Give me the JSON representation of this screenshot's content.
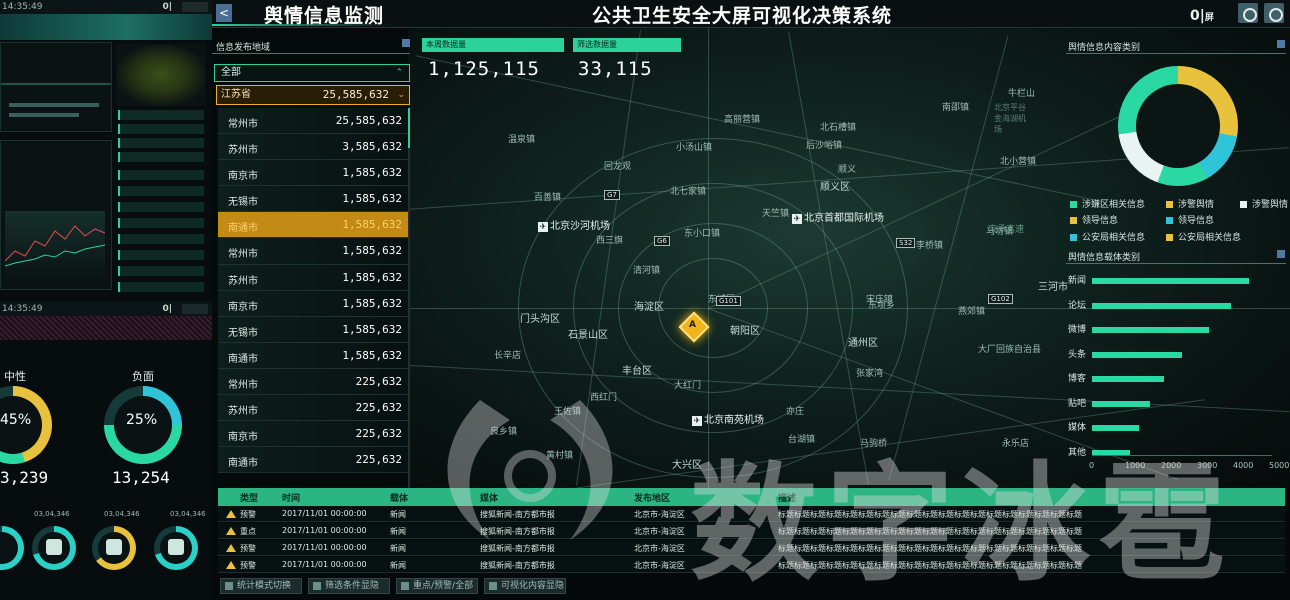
{
  "header": {
    "page_title": "舆情信息监测",
    "main_title": "公共卫生安全大屏可视化决策系统",
    "back_label": "<",
    "screen_toggle": "0|",
    "screen_toggle_suffix": "屏"
  },
  "left_strip": {
    "clock_top": "14:35:49",
    "clock_mid": "14:35:49",
    "neutral_label": "中性",
    "negative_label": "负面",
    "neutral_pct": "45%",
    "negative_pct": "25%",
    "neutral_count": "3,239",
    "negative_count": "13,254",
    "mini_counts": [
      "03,04,346",
      "03,04,346",
      "03,04,346"
    ]
  },
  "region": {
    "title": "信息发布地域",
    "all_label": "全部",
    "province": {
      "name": "江苏省",
      "value": "25,585,632"
    },
    "cities": [
      {
        "name": "常州市",
        "value": "25,585,632"
      },
      {
        "name": "苏州市",
        "value": "3,585,632"
      },
      {
        "name": "南京市",
        "value": "1,585,632"
      },
      {
        "name": "无锡市",
        "value": "1,585,632"
      },
      {
        "name": "南通市",
        "value": "1,585,632"
      },
      {
        "name": "常州市",
        "value": "1,585,632"
      },
      {
        "name": "苏州市",
        "value": "1,585,632"
      },
      {
        "name": "南京市",
        "value": "1,585,632"
      },
      {
        "name": "无锡市",
        "value": "1,585,632"
      },
      {
        "name": "南通市",
        "value": "1,585,632"
      },
      {
        "name": "常州市",
        "value": "225,632"
      },
      {
        "name": "苏州市",
        "value": "225,632"
      },
      {
        "name": "南京市",
        "value": "225,632"
      },
      {
        "name": "南通市",
        "value": "225,632"
      }
    ],
    "selected_index": 4
  },
  "counters": {
    "weekly_label": "本周数据量",
    "weekly_value": "1,125,115",
    "filtered_label": "筛选数据量",
    "filtered_value": "33,115"
  },
  "map": {
    "places": {
      "p1": "百善镇",
      "p2": "西三旗",
      "p3": "清河镇",
      "p4": "温泉镇",
      "p5": "回龙观",
      "p6": "北七家镇",
      "p7": "东小口镇",
      "p8": "小汤山镇",
      "p9": "后沙峪镇",
      "p10": "顺义区",
      "p11": "北石槽镇",
      "p12": "北小营镇",
      "p13": "李桥镇",
      "p14": "东坝乡",
      "p15": "海淀区",
      "p16": "朝阳区",
      "p17": "石景山区",
      "p18": "门头沟区",
      "p19": "丰台区",
      "p20": "东城区",
      "p21": "大兴区",
      "p22": "通州区",
      "p23": "宋庄镇",
      "p24": "马驹桥",
      "p25": "大红门",
      "p26": "亦庄",
      "p27": "台湖镇",
      "p28": "永乐店",
      "p29": "三河市",
      "p30": "燕郊镇",
      "p31": "长辛店",
      "p32": "王佐镇",
      "p33": "良乡镇",
      "p34": "黄村镇",
      "p35": "西红门",
      "p36": "张家湾",
      "p37": "大厂回族自治县",
      "p38": "马坊镇",
      "p39": "顺义",
      "p40": "牛栏山",
      "p41": "南邵镇",
      "p42": "北京平谷金海湖机场",
      "p43": "京承高速",
      "p44": "高丽营镇",
      "p45": "天竺镇"
    },
    "airports": {
      "a1": "北京首都国际机场",
      "a2": "北京南苑机场",
      "a3": "北京沙河机场"
    },
    "highways": [
      "G7",
      "G6",
      "G101",
      "G102",
      "S32"
    ],
    "marker_label": "A"
  },
  "content_types": {
    "title": "舆情信息内容类别",
    "legend": [
      {
        "label": "涉嫌区相关信息",
        "color": "#2ad8a4"
      },
      {
        "label": "涉警舆情",
        "color": "#e8c23c"
      },
      {
        "label": "涉警舆情",
        "color": "#e8f4f1"
      },
      {
        "label": "领导信息",
        "color": "#e8c23c"
      },
      {
        "label": "领导信息",
        "color": "#2fc4d8"
      },
      {
        "label": "公安局相关信息",
        "color": "#2fc4d8"
      },
      {
        "label": "公安局相关信息",
        "color": "#e8c23c"
      }
    ]
  },
  "media_types": {
    "title": "舆情信息载体类别",
    "bars": [
      {
        "label": "新闻",
        "value": 4350
      },
      {
        "label": "论坛",
        "value": 3850
      },
      {
        "label": "微博",
        "value": 3250
      },
      {
        "label": "头条",
        "value": 2500
      },
      {
        "label": "博客",
        "value": 2000
      },
      {
        "label": "贴吧",
        "value": 1600
      },
      {
        "label": "媒体",
        "value": 1300
      },
      {
        "label": "其他",
        "value": 1050
      }
    ],
    "ticks": [
      "0",
      "1000",
      "2000",
      "3000",
      "4000",
      "5000"
    ],
    "max": 5000
  },
  "table": {
    "headers": [
      "类型",
      "时间",
      "载体",
      "媒体",
      "发布地区",
      "描述"
    ],
    "rows": [
      [
        "预警",
        "2017/11/01 00:00:00",
        "新闻",
        "搜狐新闻-南方都市报",
        "北京市-海淀区",
        "标题标题标题标题标题标题标题标题标题标题标题标题标题标题标题标题标题标题标题"
      ],
      [
        "重点",
        "2017/11/01 00:00:00",
        "新闻",
        "搜狐新闻-南方都市报",
        "北京市-海淀区",
        "标题标题标题标题标题标题标题标题标题标题标题标题标题标题标题标题标题标题标题"
      ],
      [
        "预警",
        "2017/11/01 00:00:00",
        "新闻",
        "搜狐新闻-南方都市报",
        "北京市-海淀区",
        "标题标题标题标题标题标题标题标题标题标题标题标题标题标题标题标题标题标题标题"
      ],
      [
        "预警",
        "2017/11/01 00:00:00",
        "新闻",
        "搜狐新闻-南方都市报",
        "北京市-海淀区",
        "标题标题标题标题标题标题标题标题标题标题标题标题标题标题标题标题标题标题标题"
      ]
    ]
  },
  "bottom_bar": {
    "btn_stats": "统计模式切换",
    "btn_filter": "筛选条件显隐",
    "btn_focus": "重点/预警/全部",
    "btn_visual": "可视化内容显隐"
  },
  "watermark": {
    "text": "数字冰雹"
  },
  "colors": {
    "accent": "#2bd39a",
    "highlight": "#f0b11f",
    "yellow": "#e8c23c",
    "cyan": "#2fc4d8"
  }
}
